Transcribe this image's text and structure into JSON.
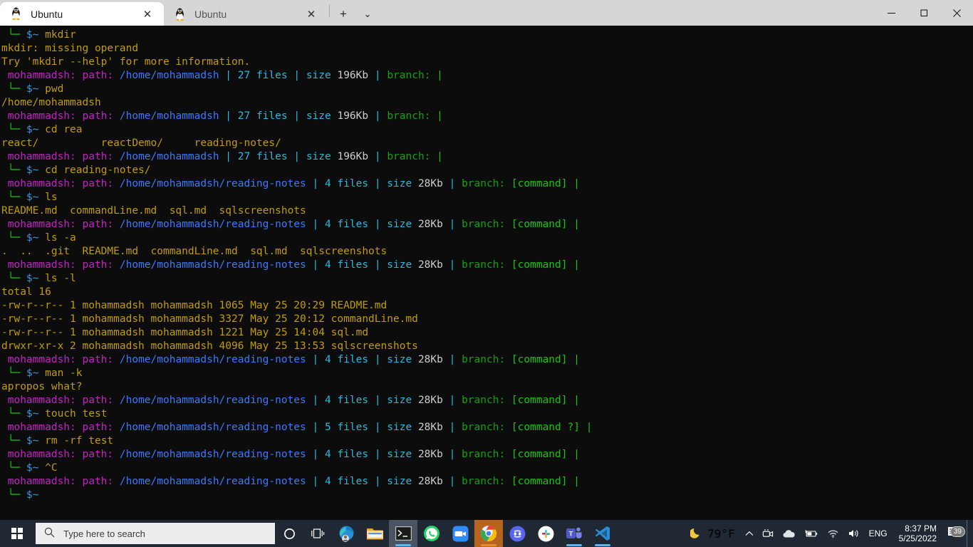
{
  "window": {
    "app": "Windows Terminal",
    "tabs": [
      {
        "label": "Ubuntu",
        "icon": "tux-icon",
        "close_label": "✕",
        "active": true
      },
      {
        "label": "Ubuntu",
        "icon": "tux-icon",
        "close_label": "✕",
        "active": false
      }
    ],
    "new_tab_label": "+",
    "dropdown_label": "⌄",
    "controls": {
      "minimize": "—",
      "maximize": "⬜",
      "close": "✕"
    }
  },
  "terminal": {
    "background": "#0c0c0c",
    "colors": {
      "yellow": "#c19c00",
      "magenta": "#c520c5",
      "blue": "#3b78ff",
      "cyan": "#3a96dd",
      "green": "#13a10e",
      "white": "#cccccc"
    },
    "prompt": {
      "branch_tree": "└─",
      "shell_sigil": "$~",
      "user": "mohammadsh:",
      "path_label": "path:",
      "files_label": "files",
      "size_label": "size",
      "branch_label": "branch:",
      "pipe": "|"
    },
    "lines": [
      {
        "type": "prompt-cmd",
        "tree": "└─",
        "sigil": "$~",
        "cmd": "mkdir"
      },
      {
        "type": "out",
        "text": "mkdir: missing operand"
      },
      {
        "type": "out",
        "text": "Try 'mkdir --help' for more information."
      },
      {
        "type": "status",
        "user": "mohammadsh:",
        "pathlbl": "path:",
        "path": "/home/mohammadsh",
        "files": "27 files",
        "size_lbl": "size",
        "size": "196Kb",
        "branch_lbl": "branch:",
        "branch": ""
      },
      {
        "type": "prompt-cmd",
        "tree": "└─",
        "sigil": "$~",
        "cmd": "pwd"
      },
      {
        "type": "out",
        "text": "/home/mohammadsh"
      },
      {
        "type": "status",
        "user": "mohammadsh:",
        "pathlbl": "path:",
        "path": "/home/mohammadsh",
        "files": "27 files",
        "size_lbl": "size",
        "size": "196Kb",
        "branch_lbl": "branch:",
        "branch": ""
      },
      {
        "type": "prompt-cmd",
        "tree": "└─",
        "sigil": "$~",
        "cmd": "cd rea"
      },
      {
        "type": "out",
        "text": "react/          reactDemo/     reading-notes/"
      },
      {
        "type": "status",
        "user": "mohammadsh:",
        "pathlbl": "path:",
        "path": "/home/mohammadsh",
        "files": "27 files",
        "size_lbl": "size",
        "size": "196Kb",
        "branch_lbl": "branch:",
        "branch": ""
      },
      {
        "type": "prompt-cmd",
        "tree": "└─",
        "sigil": "$~",
        "cmd": "cd reading-notes/"
      },
      {
        "type": "status",
        "user": "mohammadsh:",
        "pathlbl": "path:",
        "path": "/home/mohammadsh/reading-notes",
        "files": "4 files",
        "size_lbl": "size",
        "size": "28Kb",
        "branch_lbl": "branch:",
        "branch": "[command]"
      },
      {
        "type": "prompt-cmd",
        "tree": "└─",
        "sigil": "$~",
        "cmd": "ls"
      },
      {
        "type": "out",
        "text": "README.md  commandLine.md  sql.md  sqlscreenshots"
      },
      {
        "type": "status",
        "user": "mohammadsh:",
        "pathlbl": "path:",
        "path": "/home/mohammadsh/reading-notes",
        "files": "4 files",
        "size_lbl": "size",
        "size": "28Kb",
        "branch_lbl": "branch:",
        "branch": "[command]"
      },
      {
        "type": "prompt-cmd",
        "tree": "└─",
        "sigil": "$~",
        "cmd": "ls -a"
      },
      {
        "type": "out",
        "text": ".  ..  .git  README.md  commandLine.md  sql.md  sqlscreenshots"
      },
      {
        "type": "status",
        "user": "mohammadsh:",
        "pathlbl": "path:",
        "path": "/home/mohammadsh/reading-notes",
        "files": "4 files",
        "size_lbl": "size",
        "size": "28Kb",
        "branch_lbl": "branch:",
        "branch": "[command]"
      },
      {
        "type": "prompt-cmd",
        "tree": "└─",
        "sigil": "$~",
        "cmd": "ls -l"
      },
      {
        "type": "out",
        "text": "total 16"
      },
      {
        "type": "out",
        "text": "-rw-r--r-- 1 mohammadsh mohammadsh 1065 May 25 20:29 README.md"
      },
      {
        "type": "out",
        "text": "-rw-r--r-- 1 mohammadsh mohammadsh 3327 May 25 20:12 commandLine.md"
      },
      {
        "type": "out",
        "text": "-rw-r--r-- 1 mohammadsh mohammadsh 1221 May 25 14:04 sql.md"
      },
      {
        "type": "out",
        "text": "drwxr-xr-x 2 mohammadsh mohammadsh 4096 May 25 13:53 sqlscreenshots"
      },
      {
        "type": "status",
        "user": "mohammadsh:",
        "pathlbl": "path:",
        "path": "/home/mohammadsh/reading-notes",
        "files": "4 files",
        "size_lbl": "size",
        "size": "28Kb",
        "branch_lbl": "branch:",
        "branch": "[command]"
      },
      {
        "type": "prompt-cmd",
        "tree": "└─",
        "sigil": "$~",
        "cmd": "man -k"
      },
      {
        "type": "out",
        "text": "apropos what?"
      },
      {
        "type": "status",
        "user": "mohammadsh:",
        "pathlbl": "path:",
        "path": "/home/mohammadsh/reading-notes",
        "files": "4 files",
        "size_lbl": "size",
        "size": "28Kb",
        "branch_lbl": "branch:",
        "branch": "[command]"
      },
      {
        "type": "prompt-cmd",
        "tree": "└─",
        "sigil": "$~",
        "cmd": "touch test"
      },
      {
        "type": "status",
        "user": "mohammadsh:",
        "pathlbl": "path:",
        "path": "/home/mohammadsh/reading-notes",
        "files": "5 files",
        "size_lbl": "size",
        "size": "28Kb",
        "branch_lbl": "branch:",
        "branch": "[command ?]"
      },
      {
        "type": "prompt-cmd",
        "tree": "└─",
        "sigil": "$~",
        "cmd": "rm -rf test"
      },
      {
        "type": "status",
        "user": "mohammadsh:",
        "pathlbl": "path:",
        "path": "/home/mohammadsh/reading-notes",
        "files": "4 files",
        "size_lbl": "size",
        "size": "28Kb",
        "branch_lbl": "branch:",
        "branch": "[command]"
      },
      {
        "type": "prompt-cmd",
        "tree": "└─",
        "sigil": "$~",
        "cmd": "^C"
      },
      {
        "type": "status",
        "user": "mohammadsh:",
        "pathlbl": "path:",
        "path": "/home/mohammadsh/reading-notes",
        "files": "4 files",
        "size_lbl": "size",
        "size": "28Kb",
        "branch_lbl": "branch:",
        "branch": "[command]"
      },
      {
        "type": "prompt-cmd",
        "tree": "└─",
        "sigil": "$~",
        "cmd": ""
      }
    ]
  },
  "taskbar": {
    "start_label": "start-button",
    "search": {
      "placeholder": "Type here to search",
      "icon": "search-icon"
    },
    "icons": [
      {
        "name": "cortana-icon",
        "label": "Cortana"
      },
      {
        "name": "task-view-icon",
        "label": "Task View"
      },
      {
        "name": "edge-icon",
        "label": "Microsoft Edge",
        "running": true
      },
      {
        "name": "file-explorer-icon",
        "label": "File Explorer"
      },
      {
        "name": "terminal-icon",
        "label": "Windows Terminal",
        "running": true,
        "active": true
      },
      {
        "name": "whatsapp-icon",
        "label": "WhatsApp"
      },
      {
        "name": "zoom-icon",
        "label": "Zoom"
      },
      {
        "name": "chrome-icon",
        "label": "Google Chrome",
        "running": true,
        "highlight": true
      },
      {
        "name": "discord-icon",
        "label": "Discord"
      },
      {
        "name": "slack-icon",
        "label": "Slack"
      },
      {
        "name": "teams-icon",
        "label": "Microsoft Teams",
        "running": true
      },
      {
        "name": "vscode-icon",
        "label": "Visual Studio Code",
        "running": true
      }
    ],
    "tray": {
      "weather_icon": "moon-icon",
      "weather_temp": "79°F",
      "chevron": "⌃",
      "camera_icon": "camera-icon",
      "onedrive_icon": "cloud-icon",
      "battery_icon": "battery-icon",
      "wifi_icon": "wifi-icon",
      "volume_icon": "speaker-icon",
      "language": "ENG",
      "time": "8:37 PM",
      "date": "5/25/2022",
      "notification_icon": "notification-icon",
      "notification_count": "39"
    }
  }
}
